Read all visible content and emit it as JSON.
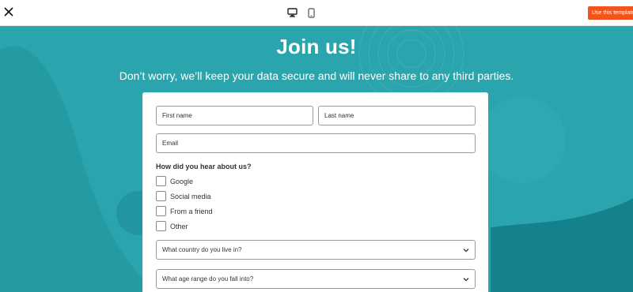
{
  "toolbar": {
    "close_icon": "close-icon",
    "desktop_icon": "desktop-icon",
    "mobile_icon": "mobile-icon",
    "use_template_label": "Use this template",
    "accent_color": "#f2541b"
  },
  "hero": {
    "title": "Join us!",
    "subtitle": "Don’t worry, we’ll keep your data secure and will never share to any third parties.",
    "background_color": "#2ba5ad"
  },
  "form": {
    "first_name": {
      "placeholder": "First name",
      "value": ""
    },
    "last_name": {
      "placeholder": "Last name",
      "value": ""
    },
    "email": {
      "placeholder": "Email",
      "value": ""
    },
    "source_question": "How did you hear about us?",
    "source_options": [
      {
        "label": "Google",
        "checked": false
      },
      {
        "label": "Social media",
        "checked": false
      },
      {
        "label": "From a friend",
        "checked": false
      },
      {
        "label": "Other",
        "checked": false
      }
    ],
    "country_select": {
      "placeholder": "What country do you live in?"
    },
    "age_select": {
      "placeholder": "What age range do you fall into?"
    }
  }
}
